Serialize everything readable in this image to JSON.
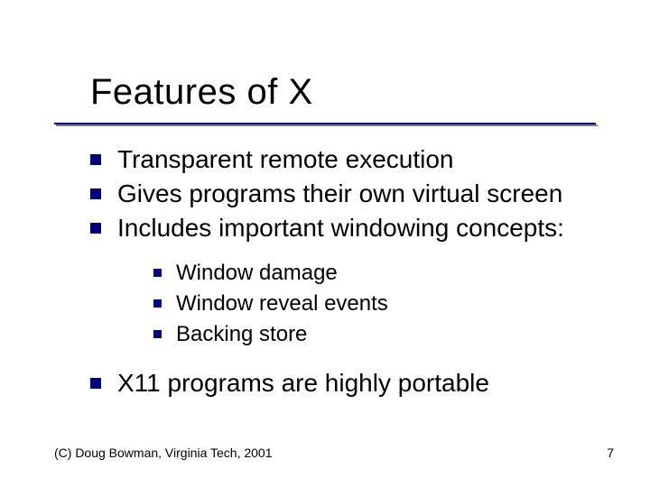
{
  "title": "Features of X",
  "bullets": {
    "b0": "Transparent remote execution",
    "b1": "Gives programs their own virtual screen",
    "b2": "Includes important windowing concepts:",
    "sub": {
      "s0": "Window damage",
      "s1": "Window reveal events",
      "s2": "Backing store"
    },
    "b3": "X11 programs are highly portable"
  },
  "footer": {
    "copyright": "(C) Doug Bowman, Virginia Tech, 2001",
    "page": "7"
  },
  "colors": {
    "accent": "#000080"
  }
}
